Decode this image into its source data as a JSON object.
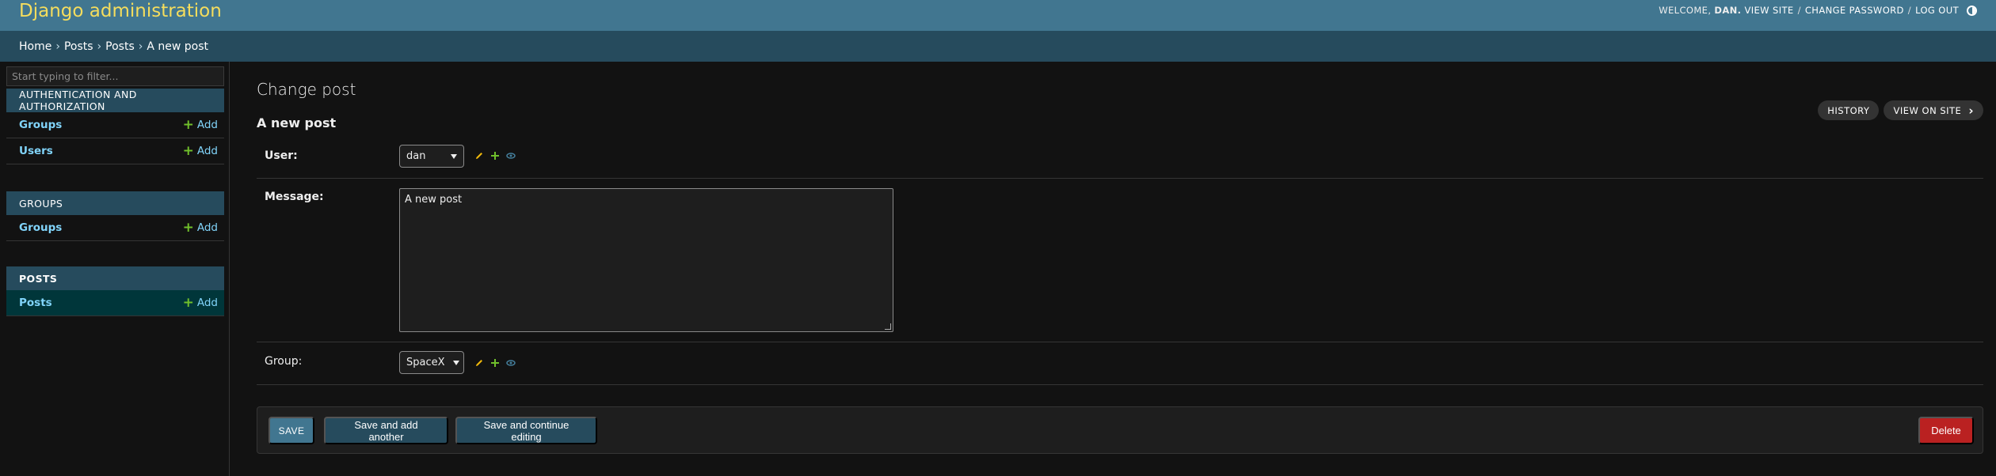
{
  "header": {
    "site_name": "Django administration",
    "welcome_prefix": "WELCOME,",
    "username": "DAN.",
    "view_site": "VIEW SITE",
    "change_password": "CHANGE PASSWORD",
    "log_out": "LOG OUT",
    "separator": "/"
  },
  "breadcrumbs": {
    "items": [
      "Home",
      "Posts",
      "Posts",
      "A new post"
    ],
    "separator": "›"
  },
  "sidebar": {
    "filter_placeholder": "Start typing to filter...",
    "modules": [
      {
        "caption": "AUTHENTICATION AND AUTHORIZATION",
        "rows": [
          {
            "name": "Groups",
            "add": "Add"
          },
          {
            "name": "Users",
            "add": "Add"
          }
        ]
      },
      {
        "caption": "GROUPS",
        "rows": [
          {
            "name": "Groups",
            "add": "Add"
          }
        ]
      },
      {
        "caption": "POSTS",
        "rows": [
          {
            "name": "Posts",
            "add": "Add"
          }
        ]
      }
    ]
  },
  "content": {
    "page_title": "Change post",
    "object_title": "A new post",
    "history_button": "HISTORY",
    "view_on_site_button": "VIEW ON SITE",
    "fields": {
      "user": {
        "label": "User:",
        "value": "dan"
      },
      "message": {
        "label": "Message:",
        "value": "A new post"
      },
      "group": {
        "label": "Group:",
        "value": "SpaceX"
      }
    },
    "submit": {
      "save": "SAVE",
      "save_add_another": "Save and add another",
      "save_continue": "Save and continue editing",
      "delete": "Delete"
    }
  },
  "colors": {
    "header_bg": "#417690",
    "breadcrumbs_bg": "#264b5d",
    "brand_yellow": "#f5dd5d",
    "link_blue": "#81d4fa",
    "add_green": "#70bf2b",
    "delete_red": "#ba2121"
  }
}
